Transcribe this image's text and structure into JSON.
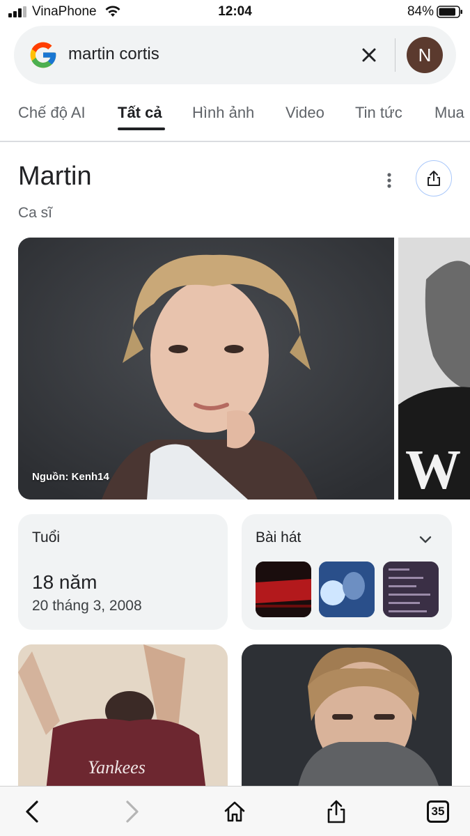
{
  "status_bar": {
    "carrier": "VinaPhone",
    "time": "12:04",
    "battery": "84%"
  },
  "search": {
    "query": "martin cortis",
    "account_initial": "N"
  },
  "tabs": [
    {
      "label": "Chế độ AI",
      "active": false
    },
    {
      "label": "Tất cả",
      "active": true
    },
    {
      "label": "Hình ảnh",
      "active": false
    },
    {
      "label": "Video",
      "active": false
    },
    {
      "label": "Tin tức",
      "active": false
    },
    {
      "label": "Mua",
      "active": false
    }
  ],
  "entity": {
    "title": "Martin",
    "subtitle": "Ca sĩ"
  },
  "images": {
    "source_label": "Nguồn: Kenh14"
  },
  "age_card": {
    "label": "Tuổi",
    "value": "18 năm",
    "birth_date": "20 tháng 3, 2008"
  },
  "songs_card": {
    "label": "Bài hát"
  },
  "toolbar": {
    "tabs_count": "35"
  },
  "colors": {
    "accent_border": "#a8c7fa",
    "avatar_bg": "#5b3a2e",
    "card_bg": "#f1f3f4"
  }
}
